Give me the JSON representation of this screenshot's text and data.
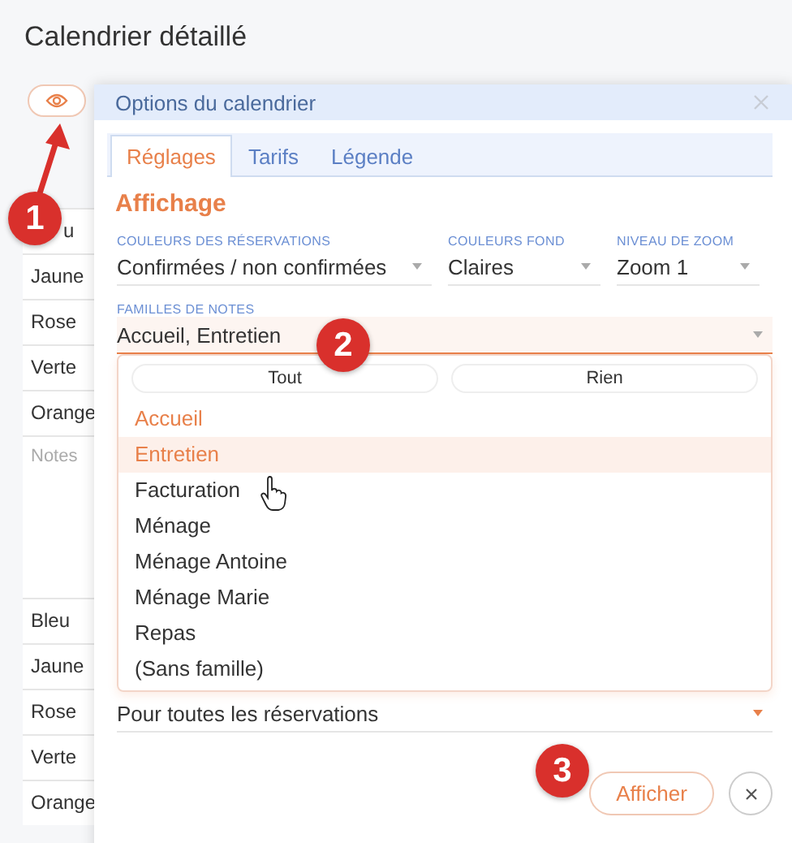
{
  "page": {
    "title": "Calendrier détaillé"
  },
  "background_lists": [
    {
      "rows": [
        "u",
        "Jaune",
        "Rose",
        "Verte",
        "Orange"
      ],
      "notes": "Notes"
    },
    {
      "rows": [
        "Bleu",
        "Jaune",
        "Rose",
        "Verte",
        "Orange"
      ]
    }
  ],
  "dialog": {
    "title": "Options du calendrier",
    "tabs": [
      {
        "label": "Réglages",
        "selected": true
      },
      {
        "label": "Tarifs",
        "selected": false
      },
      {
        "label": "Légende",
        "selected": false
      }
    ],
    "section": "Affichage",
    "fields": [
      {
        "label": "COULEURS DES RÉSERVATIONS",
        "value": "Confirmées / non confirmées"
      },
      {
        "label": "COULEURS FOND",
        "value": "Claires"
      },
      {
        "label": "NIVEAU DE ZOOM",
        "value": "Zoom 1"
      }
    ],
    "notes_field": {
      "label": "FAMILLES DE NOTES",
      "value": "Accueil, Entretien",
      "expanded": true
    },
    "dropdown": {
      "buttons": [
        "Tout",
        "Rien"
      ],
      "options": [
        {
          "label": "Accueil",
          "selected": true,
          "hovered": false
        },
        {
          "label": "Entretien",
          "selected": true,
          "hovered": true
        },
        {
          "label": "Facturation",
          "selected": false,
          "hovered": false
        },
        {
          "label": "Ménage",
          "selected": false,
          "hovered": false
        },
        {
          "label": "Ménage Antoine",
          "selected": false,
          "hovered": false
        },
        {
          "label": "Ménage Marie",
          "selected": false,
          "hovered": false
        },
        {
          "label": "Repas",
          "selected": false,
          "hovered": false
        },
        {
          "label": "(Sans famille)",
          "selected": false,
          "hovered": false
        }
      ]
    },
    "scope_field": {
      "value": "Pour toutes les réservations"
    },
    "submit": "Afficher"
  },
  "annotations": [
    {
      "number": "1"
    },
    {
      "number": "2"
    },
    {
      "number": "3"
    }
  ]
}
